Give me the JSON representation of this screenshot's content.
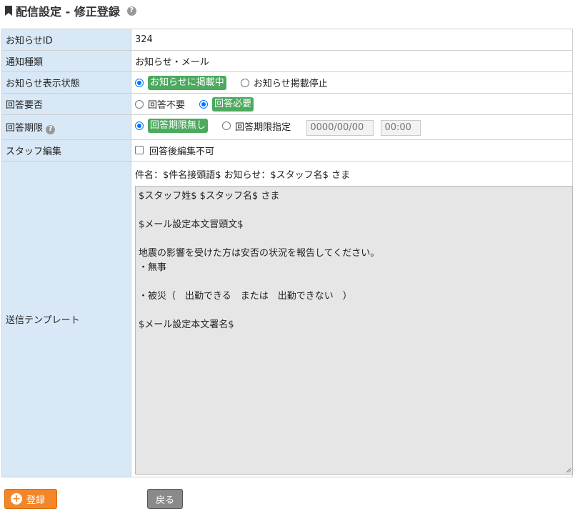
{
  "page": {
    "title": "配信設定 - 修正登録",
    "help_icon": "question-circle-icon"
  },
  "labels": {
    "notice_id": "お知らせID",
    "notice_type": "通知種類",
    "display_status": "お知らせ表示状態",
    "answer_required": "回答要否",
    "answer_deadline": "回答期限",
    "staff_edit": "スタッフ編集",
    "template": "送信テンプレート"
  },
  "values": {
    "notice_id": "324",
    "notice_type": "お知らせ・メール"
  },
  "display_status": {
    "selected": "お知らせに掲載中",
    "other": "お知らせ掲載停止"
  },
  "answer_required": {
    "not_required": "回答不要",
    "selected": "回答必要"
  },
  "answer_deadline": {
    "selected": "回答期限無し",
    "specify": "回答期限指定",
    "date_placeholder": "0000/00/00",
    "time_placeholder": "00:00"
  },
  "staff_edit": {
    "checkbox_label": "回答後編集不可",
    "checked": false
  },
  "template": {
    "subject": "件名：$件名接頭語$ お知らせ：$スタッフ名$ さま",
    "body_lines": [
      "$スタッフ姓$ $スタッフ名$ さま",
      "",
      "$メール設定本文冒頭文$",
      "",
      "地震の影響を受けた方は安否の状況を報告してください。",
      "・無事",
      "",
      "・被災（　出勤できる　または　出勤できない　）",
      "",
      "$メール設定本文署名$"
    ]
  },
  "buttons": {
    "register": "登録",
    "back": "戻る"
  },
  "colors": {
    "label_bg": "#d8e8f6",
    "badge_green": "#4caa5e",
    "register_orange": "#f4862a",
    "back_gray": "#8a8a8a",
    "radio_blue": "#0075ff"
  }
}
